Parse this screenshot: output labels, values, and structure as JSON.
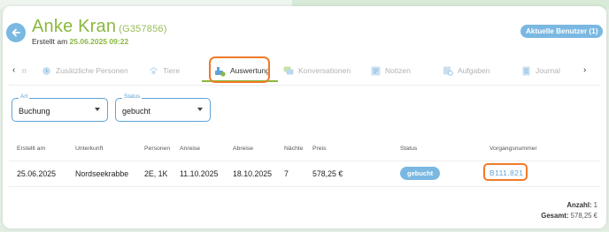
{
  "header": {
    "name": "Anke Kran",
    "code": "(G357856)",
    "created_label": "Erstellt am",
    "created_date": "25.06.2025 09:22",
    "users_button": "Aktuelle Benutzer (1)"
  },
  "tabs": {
    "cut_label": "n",
    "items": [
      {
        "label": "Zusätzliche Personen"
      },
      {
        "label": "Tiere"
      },
      {
        "label": "Auswertung"
      },
      {
        "label": "Konversationen"
      },
      {
        "label": "Notizen"
      },
      {
        "label": "Aufgaben"
      },
      {
        "label": "Journal"
      }
    ],
    "prev_icon": "‹",
    "next_icon": "›"
  },
  "filters": {
    "art": {
      "legend": "Art",
      "value": "Buchung"
    },
    "status": {
      "legend": "Status",
      "value": "gebucht"
    }
  },
  "table": {
    "headers": [
      "Erstellt am",
      "Unterkunft",
      "Personen",
      "Anreise",
      "Abreise",
      "Nächte",
      "Preis",
      "Status",
      "Vorgangsnummer"
    ],
    "row": {
      "erstellt": "25.06.2025",
      "unterkunft": "Nordseekrabbe",
      "personen": "2E, 1K",
      "anreise": "11.10.2025",
      "abreise": "18.10.2025",
      "naechte": "7",
      "preis": "578,25 €",
      "status": "gebucht",
      "vorgangsnummer": "B111.821"
    }
  },
  "summary": {
    "anzahl_label": "Anzahl:",
    "anzahl_value": "1",
    "gesamt_label": "Gesamt:",
    "gesamt_value": "578,25 €"
  },
  "colors": {
    "accent_green": "#8ab83e",
    "accent_blue": "#7ab8e2",
    "highlight_orange": "#f07a2a"
  }
}
